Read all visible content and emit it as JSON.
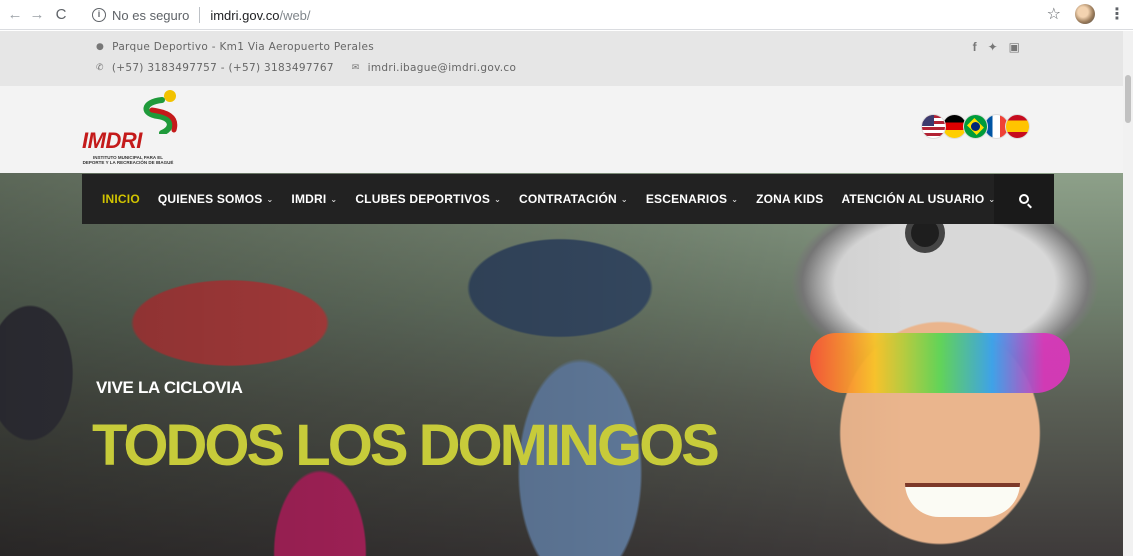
{
  "browser": {
    "security_label": "No es seguro",
    "url_host": "imdri.gov.co",
    "url_path": "/web/"
  },
  "topbar": {
    "address": "Parque Deportivo - Km1 Via Aeropuerto Perales",
    "phones": "(+57) 3183497757 - (+57) 3183497767",
    "email": "imdri.ibague@imdri.gov.co",
    "social_icons": [
      "facebook-icon",
      "twitter-icon",
      "youtube-icon"
    ]
  },
  "logo": {
    "name": "IMDRI",
    "subtitle": "INSTITUTO MUNICIPAL PARA EL DEPORTE Y LA RECREACIÓN DE IBAGUÉ"
  },
  "languages": [
    "us",
    "de",
    "br",
    "fr",
    "es"
  ],
  "nav": {
    "items": [
      {
        "label": "INICIO",
        "dropdown": false,
        "active": true
      },
      {
        "label": "QUIENES SOMOS",
        "dropdown": true,
        "active": false
      },
      {
        "label": "IMDRI",
        "dropdown": true,
        "active": false
      },
      {
        "label": "CLUBES DEPORTIVOS",
        "dropdown": true,
        "active": false
      },
      {
        "label": "CONTRATACIÓN",
        "dropdown": true,
        "active": false
      },
      {
        "label": "ESCENARIOS",
        "dropdown": true,
        "active": false
      },
      {
        "label": "ZONA KIDS",
        "dropdown": false,
        "active": false
      },
      {
        "label": "ATENCIÓN AL USUARIO",
        "dropdown": true,
        "active": false
      }
    ],
    "active_color": "#d1c400"
  },
  "hero": {
    "kicker": "VIVE LA CICLOVIA",
    "title": "TODOS LOS DOMINGOS",
    "title_color": "#c7cb3a"
  }
}
